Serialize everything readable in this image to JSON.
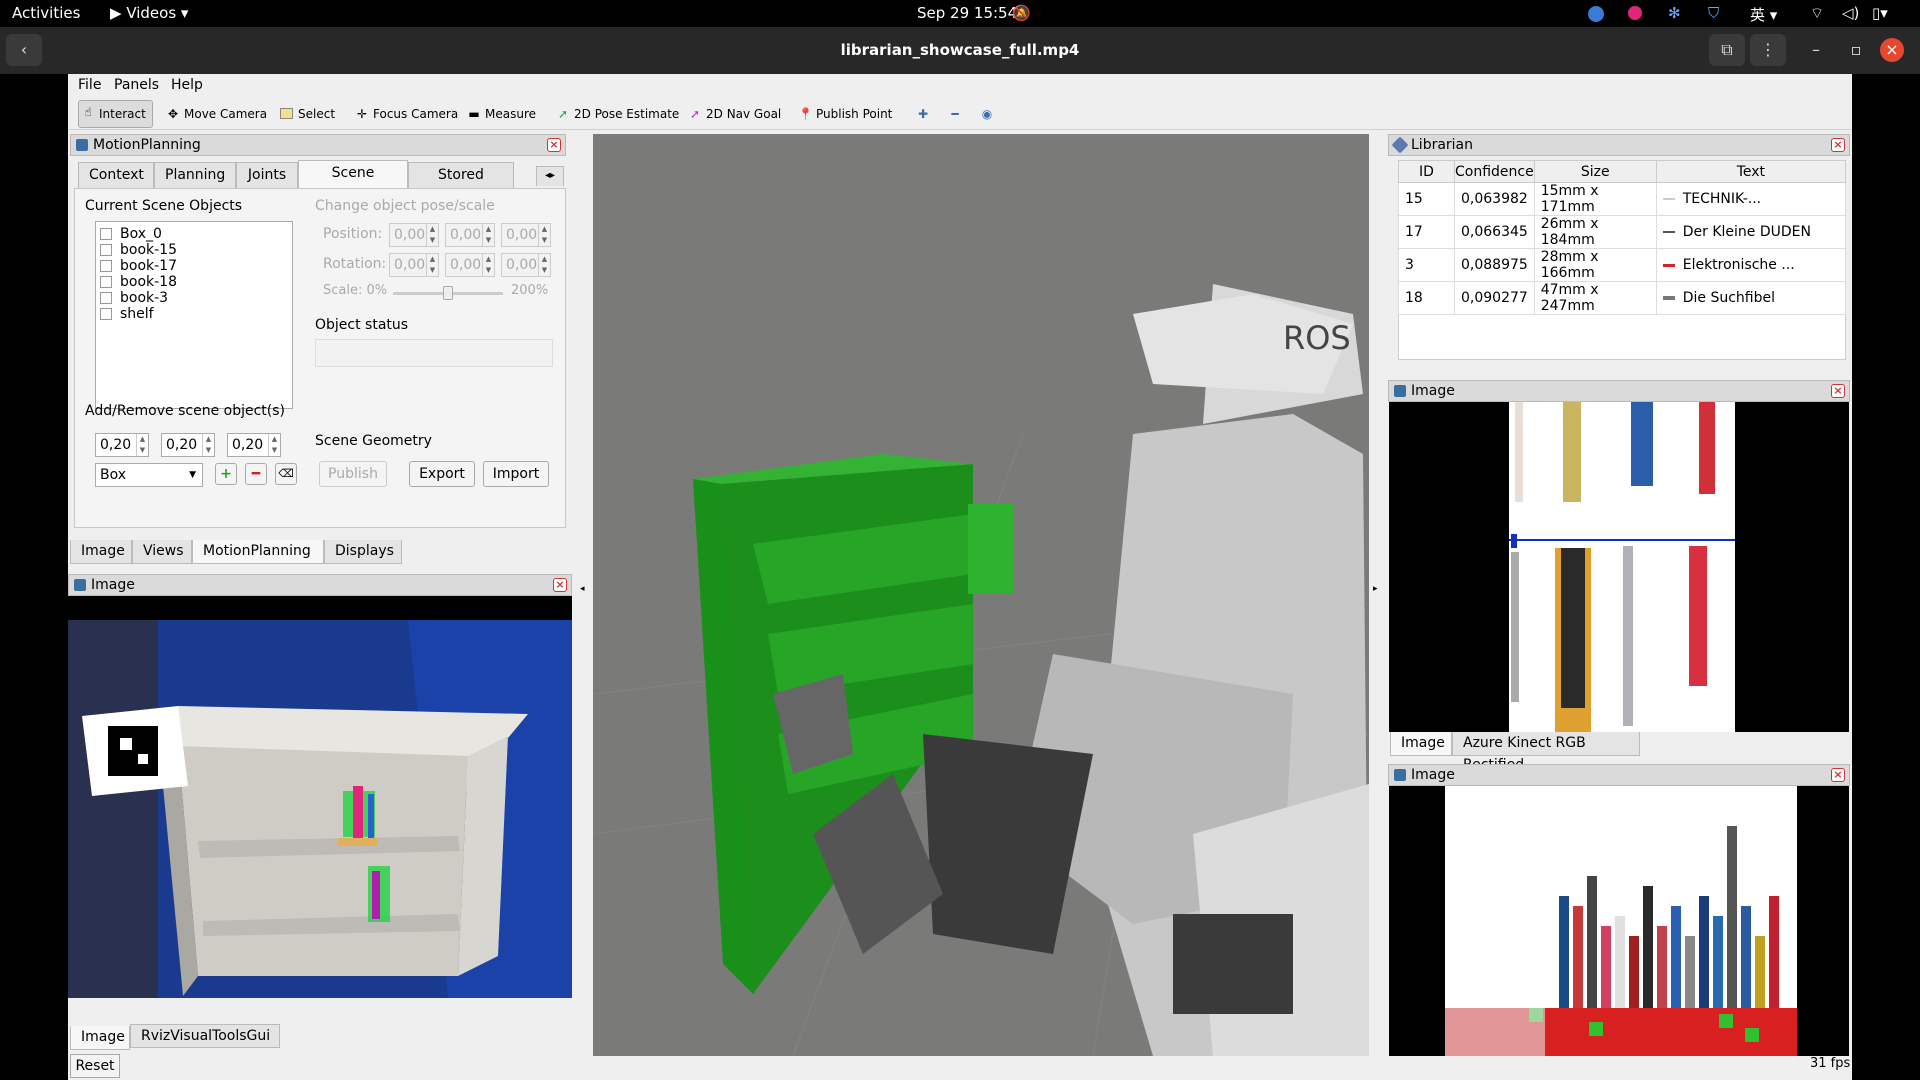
{
  "topbar": {
    "activities": "Activities",
    "app": "Videos",
    "clock": "Sep 29  15:54",
    "lang": "英"
  },
  "window": {
    "title": "librarian_showcase_full.mp4"
  },
  "menu": {
    "file": "File",
    "panels": "Panels",
    "help": "Help"
  },
  "toolbar": {
    "interact": "Interact",
    "move_camera": "Move Camera",
    "select": "Select",
    "focus_camera": "Focus Camera",
    "measure": "Measure",
    "pose_estimate": "2D Pose Estimate",
    "nav_goal": "2D Nav Goal",
    "publish_point": "Publish Point"
  },
  "motion_planning": {
    "title": "MotionPlanning",
    "tabs": [
      "Context",
      "Planning",
      "Joints",
      "Scene Objects",
      "Stored Scenes"
    ],
    "current_objects_label": "Current Scene Objects",
    "objects": [
      "Box_0",
      "book-15",
      "book-17",
      "book-18",
      "book-3",
      "shelf"
    ],
    "change_pose_label": "Change object pose/scale",
    "position_label": "Position:",
    "rotation_label": "Rotation:",
    "scale_label": "Scale:",
    "scale_min": "0%",
    "scale_max": "200%",
    "pose_value": "0,00",
    "object_status_label": "Object status",
    "add_remove_label": "Add/Remove scene object(s)",
    "dims": [
      "0,20",
      "0,20",
      "0,20"
    ],
    "shape": "Box",
    "scene_geometry_label": "Scene Geometry",
    "publish": "Publish",
    "export": "Export",
    "import": "Import"
  },
  "left_bottom_tabs": [
    "Image",
    "Views",
    "MotionPlanning",
    "Displays"
  ],
  "image_panel_left": {
    "title": "Image",
    "tabs": [
      "Image",
      "RvizVisualToolsGui"
    ],
    "reset": "Reset"
  },
  "librarian": {
    "title": "Librarian",
    "columns": [
      "ID",
      "Confidence",
      "Size",
      "Text"
    ],
    "rows": [
      {
        "id": "15",
        "confidence": "0,063982",
        "size": "15mm x 171mm",
        "text": "TECHNIK-...",
        "color": "#cccccc"
      },
      {
        "id": "17",
        "confidence": "0,066345",
        "size": "26mm x 184mm",
        "text": "Der Kleine DUDEN",
        "color": "#555555"
      },
      {
        "id": "3",
        "confidence": "0,088975",
        "size": "28mm x 166mm",
        "text": "Elektronische ...",
        "color": "#d9212a"
      },
      {
        "id": "18",
        "confidence": "0,090277",
        "size": "47mm x 247mm",
        "text": "Die Suchfibel",
        "color": "#777777"
      }
    ]
  },
  "image_panel_right1": {
    "title": "Image",
    "tabs": [
      "Image",
      "Azure Kinect RGB Rectified"
    ]
  },
  "image_panel_right2": {
    "title": "Image"
  },
  "status": {
    "fps": "31 fps"
  },
  "viewport": {
    "ros_label": "ROS"
  }
}
